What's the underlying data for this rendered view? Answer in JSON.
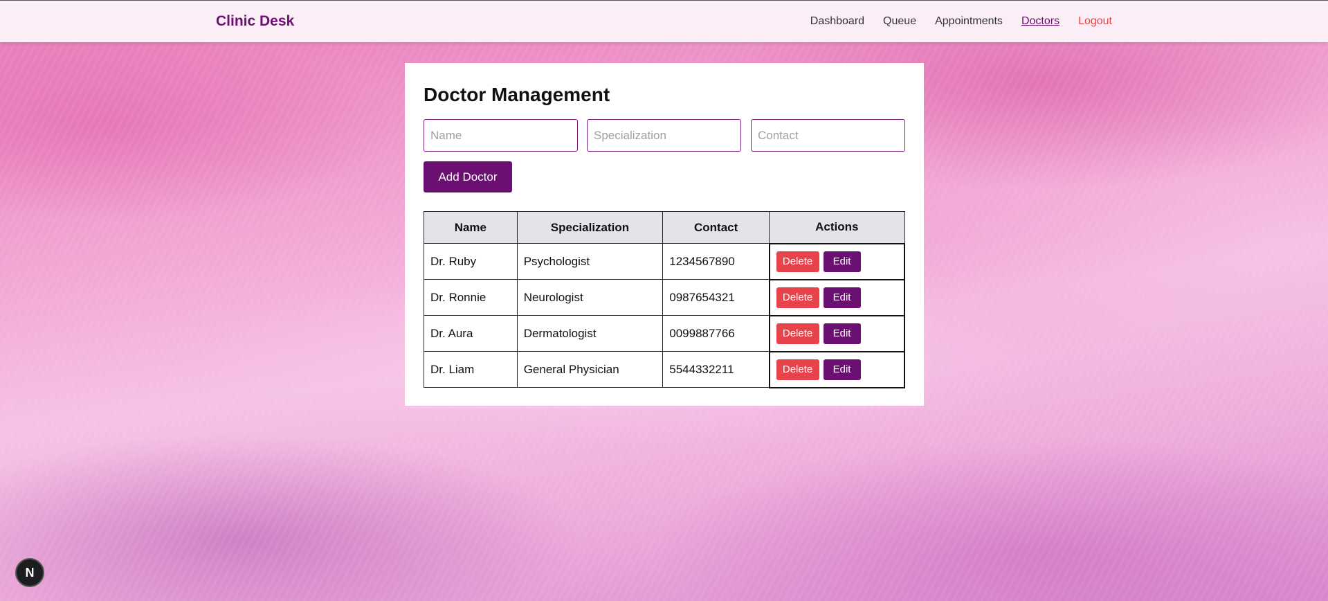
{
  "navbar": {
    "brand": "Clinic Desk",
    "links": [
      "Dashboard",
      "Queue",
      "Appointments",
      "Doctors",
      "Logout"
    ],
    "active": "Doctors"
  },
  "card": {
    "title": "Doctor Management",
    "inputs": {
      "name_placeholder": "Name",
      "specialization_placeholder": "Specialization",
      "contact_placeholder": "Contact"
    },
    "add_button": "Add Doctor"
  },
  "table": {
    "headers": [
      "Name",
      "Specialization",
      "Contact",
      "Actions"
    ],
    "rows": [
      {
        "name": "Dr. Ruby",
        "specialization": "Psychologist",
        "contact": "1234567890"
      },
      {
        "name": "Dr. Ronnie",
        "specialization": "Neurologist",
        "contact": "0987654321"
      },
      {
        "name": "Dr. Aura",
        "specialization": "Dermatologist",
        "contact": "0099887766"
      },
      {
        "name": "Dr. Liam",
        "specialization": "General Physician",
        "contact": "5544332211"
      }
    ],
    "delete_label": "Delete",
    "edit_label": "Edit"
  },
  "badge": {
    "letter": "N"
  },
  "colors": {
    "brand": "#6b0f72",
    "danger": "#e8434a",
    "header_bg": "#e3e4e8"
  }
}
